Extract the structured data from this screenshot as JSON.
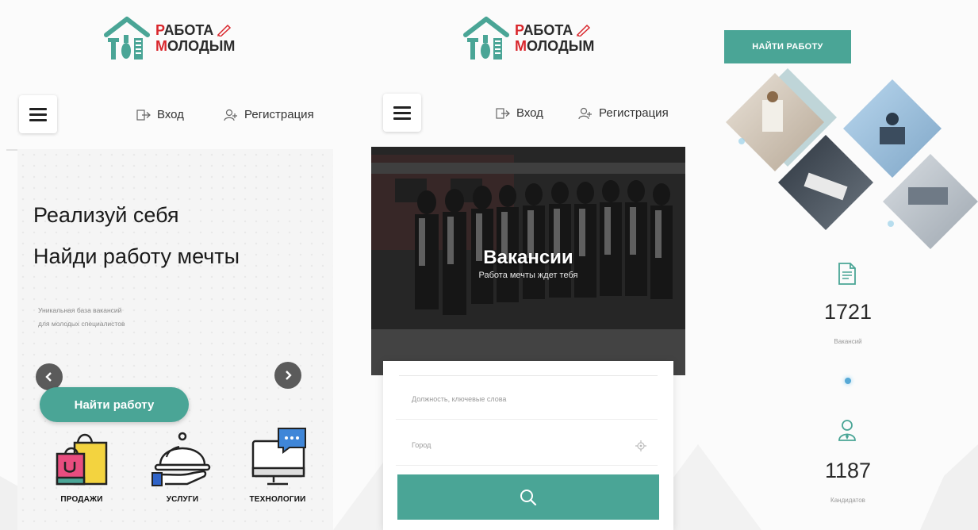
{
  "brand": {
    "line1": "РАБОТА",
    "line2_first": "М",
    "line2_rest": "ОЛОДЫМ",
    "line1_first": "Р",
    "line1_rest": "АБОТА",
    "accent_color": "#4aa596",
    "red_color": "#d9262c"
  },
  "nav": {
    "login_label": "Вход",
    "register_label": "Регистрация"
  },
  "screen1": {
    "hero_line1": "Реализуй себя",
    "hero_line2": "Найди работу мечты",
    "hero_sub_line1": "Уникальная база вакансий",
    "hero_sub_line2": "для молодых специалистов",
    "find_button": "Найти работу",
    "categories": [
      {
        "label": "ПРОДАЖИ",
        "icon": "shopping-bags-icon"
      },
      {
        "label": "УСЛУГИ",
        "icon": "cloche-icon"
      },
      {
        "label": "ТЕХНОЛОГИИ",
        "icon": "computer-chat-icon"
      }
    ]
  },
  "screen2": {
    "banner_title": "Вакансии",
    "banner_subtitle": "Работа мечты ждет тебя",
    "keyword_placeholder": "Должность, ключевые слова",
    "city_placeholder": "Город",
    "search_icon": "search-icon"
  },
  "screen3": {
    "find_job_button": "НАЙТИ РАБОТУ",
    "stats": [
      {
        "number": "1721",
        "label": "Вакансий",
        "icon": "document-icon"
      },
      {
        "number": "1187",
        "label": "Кандидатов",
        "icon": "user-icon"
      }
    ]
  }
}
